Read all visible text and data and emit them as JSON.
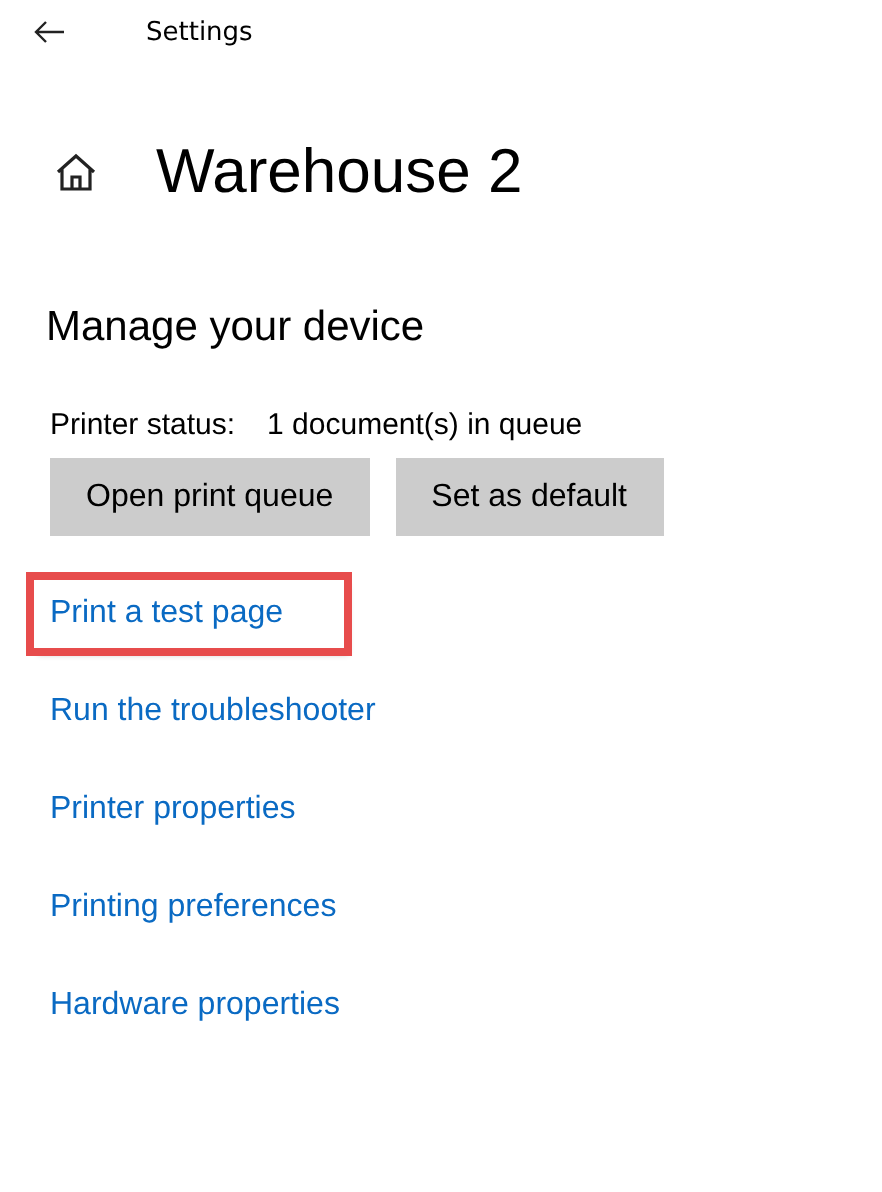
{
  "window": {
    "title": "Settings"
  },
  "page": {
    "title": "Warehouse 2"
  },
  "section": {
    "title": "Manage your device"
  },
  "status": {
    "label": "Printer status:",
    "value": "1 document(s) in queue"
  },
  "buttons": [
    "Open print queue",
    "Set as default"
  ],
  "links": [
    {
      "label": "Print a test page",
      "highlighted": true
    },
    {
      "label": "Run the troubleshooter",
      "highlighted": false
    },
    {
      "label": "Printer properties",
      "highlighted": false
    },
    {
      "label": "Printing preferences",
      "highlighted": false
    },
    {
      "label": "Hardware properties",
      "highlighted": false
    }
  ]
}
